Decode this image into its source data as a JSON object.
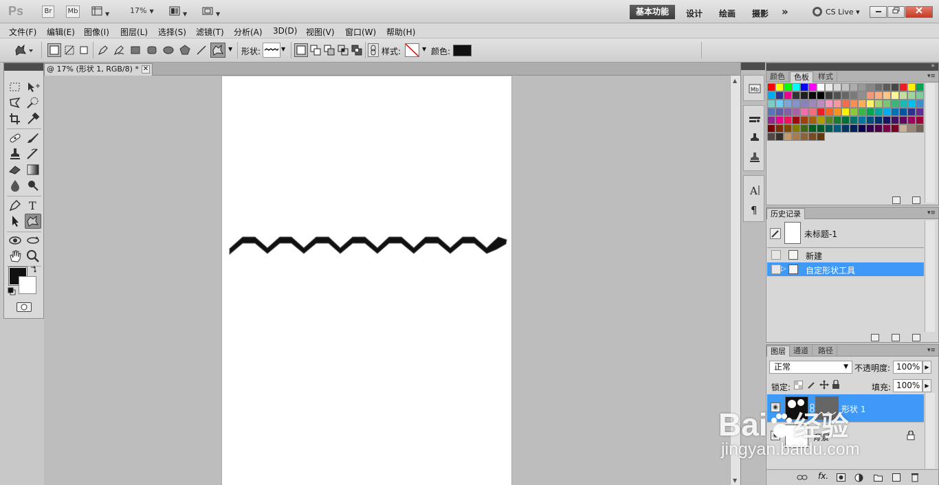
{
  "app": {
    "logo": "Ps",
    "bridge_button": "Br",
    "minibridge_button": "Mb",
    "zoom": "17%",
    "workspaces": [
      "基本功能",
      "设计",
      "绘画",
      "摄影"
    ],
    "workspace_more": "»",
    "cs_live": "CS Live"
  },
  "menu": [
    "文件(F)",
    "编辑(E)",
    "图像(I)",
    "图层(L)",
    "选择(S)",
    "滤镜(T)",
    "分析(A)",
    "3D(D)",
    "视图(V)",
    "窗口(W)",
    "帮助(H)"
  ],
  "options": {
    "shape_label": "形状:",
    "style_label": "样式:",
    "color_label": "颜色:",
    "color_value": "#111111"
  },
  "document": {
    "tab_title": "@ 17% (形状 1, RGB/8) *",
    "close_glyph": "✕"
  },
  "swatches_panel": {
    "tabs": [
      "颜色",
      "色板",
      "样式"
    ],
    "active_tab": "色板",
    "colors": [
      "#ff0000",
      "#ffff00",
      "#00ff00",
      "#00ffff",
      "#0000ff",
      "#ff00ff",
      "#ffffff",
      "#ebebeb",
      "#d6d6d6",
      "#c2c2c2",
      "#adadad",
      "#999999",
      "#858585",
      "#707070",
      "#5c5c5c",
      "#474747",
      "#ed1c24",
      "#fff200",
      "#00a651",
      "#00aeef",
      "#2e3192",
      "#ec008c",
      "#333333",
      "#1f1f1f",
      "#0a0a0a",
      "#000000",
      "#3d3d3d",
      "#525252",
      "#666666",
      "#7a7a7a",
      "#8f8f8f",
      "#f7977a",
      "#f9ad81",
      "#fdc68a",
      "#fff79a",
      "#c4df9b",
      "#a2d39c",
      "#82ca9d",
      "#7bcdc8",
      "#6ecff6",
      "#7ea7d8",
      "#8493ca",
      "#8882be",
      "#a187be",
      "#bc8dbf",
      "#f49ac2",
      "#f6989d",
      "#f26c4f",
      "#f68e55",
      "#fbaf5c",
      "#fff467",
      "#acd372",
      "#7cc576",
      "#3bb878",
      "#1abbb4",
      "#00bff3",
      "#438ccb",
      "#5574b9",
      "#605ca8",
      "#855fa8",
      "#a763a8",
      "#f06ea9",
      "#f26d7d",
      "#ed1c24",
      "#f26522",
      "#f7941d",
      "#fff200",
      "#8dc63f",
      "#39b54a",
      "#00a651",
      "#00a99d",
      "#00aeef",
      "#0072bc",
      "#0054a6",
      "#2e3192",
      "#662d91",
      "#92278f",
      "#ec008c",
      "#ed145b",
      "#9e0b0f",
      "#a0410d",
      "#a36209",
      "#aba000",
      "#598527",
      "#197b30",
      "#007236",
      "#00746b",
      "#0076a3",
      "#004b80",
      "#003471",
      "#1b1464",
      "#440e62",
      "#630460",
      "#9e005d",
      "#9e0039",
      "#790000",
      "#7b2e00",
      "#7d4900",
      "#827b00",
      "#406618",
      "#005e20",
      "#005826",
      "#005952",
      "#005b7f",
      "#003663",
      "#002157",
      "#0d004c",
      "#32004b",
      "#4b0049",
      "#7b0046",
      "#7a0026",
      "#c7b299",
      "#998675",
      "#736357",
      "#534741",
      "#37302a",
      "#c69c6d",
      "#a67c52",
      "#8c6239",
      "#754c24",
      "#603913"
    ]
  },
  "history_panel": {
    "title": "历史记录",
    "snapshot": "未标题-1",
    "items": [
      "新建",
      "自定形状工具"
    ],
    "selected_index": 1
  },
  "layers_panel": {
    "tabs": [
      "图层",
      "通道",
      "路径"
    ],
    "blend_mode": "正常",
    "opacity_label": "不透明度:",
    "opacity_value": "100%",
    "lock_label": "锁定:",
    "fill_label": "填充:",
    "fill_value": "100%",
    "layers": [
      {
        "name": "形状 1",
        "selected": true
      },
      {
        "name": "背景",
        "selected": false
      }
    ]
  },
  "watermark": {
    "brand": "Bai",
    "brand_tail": "经验",
    "url": "jingyan.baidu.com"
  }
}
